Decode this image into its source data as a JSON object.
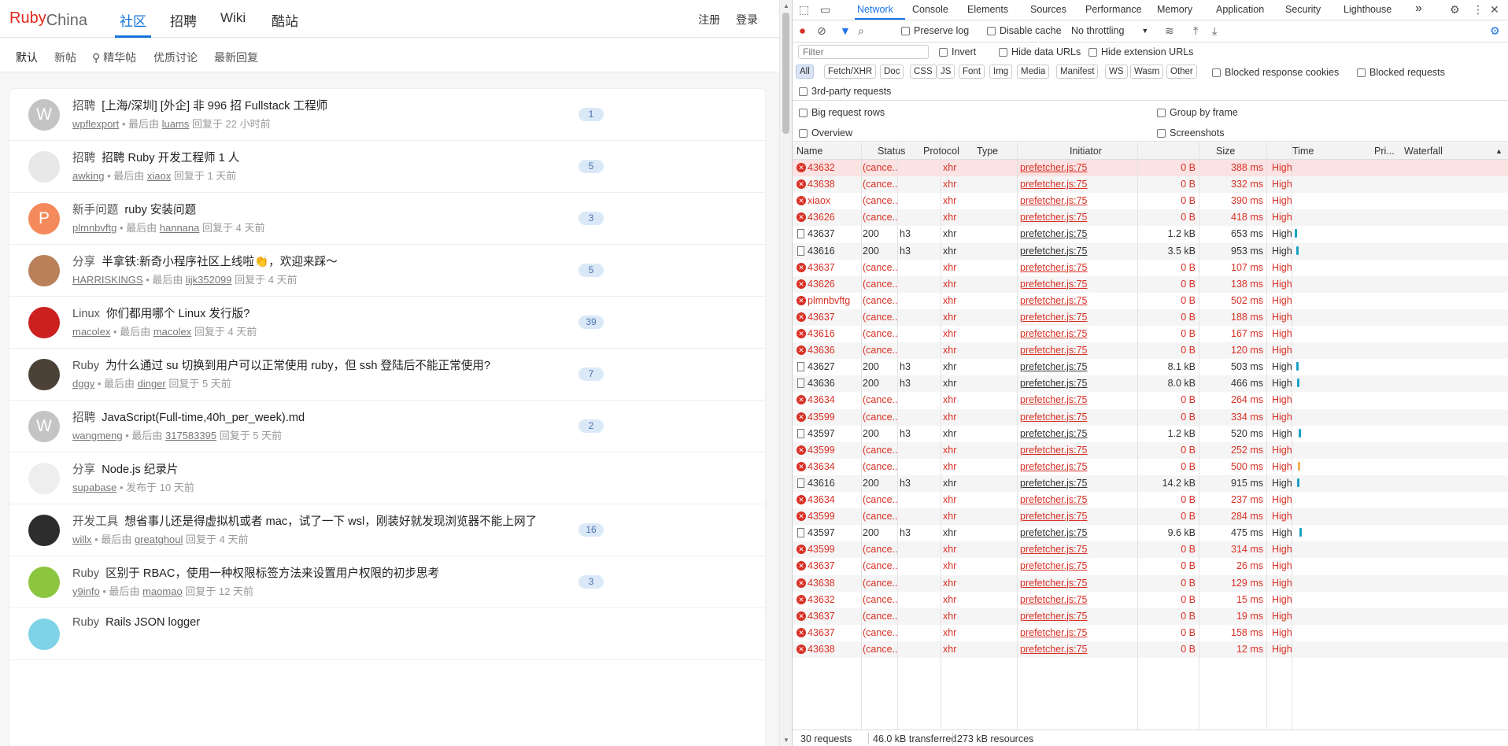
{
  "site": {
    "brand_ruby": "Ruby",
    "brand_china": "China",
    "nav": [
      "社区",
      "招聘",
      "Wiki",
      "酷站"
    ],
    "signup": "注册",
    "login": "登录",
    "subnav": [
      "默认",
      "新帖",
      "精华帖",
      "优质讨论",
      "最新回复"
    ]
  },
  "topics": [
    {
      "avatar_letter": "W",
      "avatar_color": "#c4c4c4",
      "node": "招聘",
      "title": "[上海/深圳] [外企] 非 996 招 Fullstack 工程师",
      "author": "wpflexport",
      "mid": " • 最后由 ",
      "last": "luams",
      "time": " 回复于 22 小时前",
      "count": "1"
    },
    {
      "avatar_letter": "",
      "avatar_color": "#e8e8e8",
      "node": "招聘",
      "title": "招聘 Ruby 开发工程师 1 人",
      "author": "awking",
      "mid": " • 最后由 ",
      "last": "xiaox",
      "time": " 回复于 1 天前",
      "count": "5"
    },
    {
      "avatar_letter": "P",
      "avatar_color": "#f48a5c",
      "node": "新手问题",
      "title": "ruby 安装问题",
      "author": "plmnbvftg",
      "mid": " • 最后由 ",
      "last": "hannana",
      "time": " 回复于 4 天前",
      "count": "3"
    },
    {
      "avatar_letter": "",
      "avatar_color": "#b9805a",
      "node": "分享",
      "title": "半拿铁:新奇小程序社区上线啦👏，欢迎来踩～",
      "author": "HARRISKINGS",
      "mid": " • 最后由 ",
      "last": "lijk352099",
      "time": " 回复于 4 天前",
      "count": "5"
    },
    {
      "avatar_letter": "",
      "avatar_color": "#cc1f1f",
      "node": "Linux",
      "title": "你们都用哪个 Linux 发行版?",
      "author": "macolex",
      "mid": " • 最后由 ",
      "last": "macolex",
      "time": " 回复于 4 天前",
      "count": "39"
    },
    {
      "avatar_letter": "",
      "avatar_color": "#4b4136",
      "node": "Ruby",
      "title": "为什么通过 su 切换到用户可以正常使用 ruby，但 ssh 登陆后不能正常使用?",
      "author": "dggy",
      "mid": " • 最后由 ",
      "last": "dinger",
      "time": " 回复于 5 天前",
      "count": "7"
    },
    {
      "avatar_letter": "W",
      "avatar_color": "#c4c4c4",
      "node": "招聘",
      "title": "JavaScript(Full-time,40h_per_week).md",
      "author": "wangmeng",
      "mid": " • 最后由 ",
      "last": "317583395",
      "time": " 回复于 5 天前",
      "count": "2"
    },
    {
      "avatar_letter": "",
      "avatar_color": "#eeeeee",
      "node": "分享",
      "title": "Node.js 纪录片",
      "author": "supabase",
      "mid": " • 发布于 10 天前",
      "last": "",
      "time": "",
      "count": ""
    },
    {
      "avatar_letter": "",
      "avatar_color": "#2d2d2d",
      "node": "开发工具",
      "title": "想省事儿还是得虚拟机或者 mac，试了一下 wsl，刚装好就发现浏览器不能上网了",
      "author": "willx",
      "mid": " • 最后由 ",
      "last": "greatghoul",
      "time": " 回复于 4 天前",
      "count": "16"
    },
    {
      "avatar_letter": "",
      "avatar_color": "#8cc63f",
      "node": "Ruby",
      "title": "区别于 RBAC，使用一种权限标签方法来设置用户权限的初步思考",
      "author": "y9info",
      "mid": " • 最后由 ",
      "last": "maomao",
      "time": " 回复于 12 天前",
      "count": "3"
    },
    {
      "avatar_letter": "",
      "avatar_color": "#7fd3e6",
      "node": "Ruby",
      "title": "Rails JSON logger",
      "author": "",
      "mid": "",
      "last": "",
      "time": "",
      "count": ""
    }
  ],
  "devtools": {
    "tabs": [
      "Network",
      "Console",
      "Elements",
      "Sources",
      "Performance",
      "Memory",
      "Application",
      "Security",
      "Lighthouse"
    ],
    "more": "»",
    "preserve_log": "Preserve log",
    "disable_cache": "Disable cache",
    "throttling": "No throttling",
    "filter_placeholder": "Filter",
    "invert": "Invert",
    "hide_data_urls": "Hide data URLs",
    "hide_ext_urls": "Hide extension URLs",
    "type_chips": [
      "All",
      "Fetch/XHR",
      "Doc",
      "CSS",
      "JS",
      "Font",
      "Img",
      "Media",
      "Manifest",
      "WS",
      "Wasm",
      "Other"
    ],
    "blocked_cookies": "Blocked response cookies",
    "blocked_requests": "Blocked requests",
    "third_party": "3rd-party requests",
    "big_rows": "Big request rows",
    "group_by_frame": "Group by frame",
    "overview": "Overview",
    "screenshots": "Screenshots",
    "columns": [
      "Name",
      "Status",
      "Protocol",
      "Type",
      "Initiator",
      "Size",
      "Time",
      "Pri...",
      "Waterfall"
    ],
    "requests": [
      {
        "name": "43632",
        "status": "(cance...",
        "protocol": "",
        "type": "xhr",
        "initiator": "prefetcher.js:75",
        "size": "0 B",
        "time": "388 ms",
        "priority": "High",
        "error": true,
        "wf": 0
      },
      {
        "name": "43638",
        "status": "(cance...",
        "protocol": "",
        "type": "xhr",
        "initiator": "prefetcher.js:75",
        "size": "0 B",
        "time": "332 ms",
        "priority": "High",
        "error": true,
        "wf": 0
      },
      {
        "name": "xiaox",
        "status": "(cance...",
        "protocol": "",
        "type": "xhr",
        "initiator": "prefetcher.js:75",
        "size": "0 B",
        "time": "390 ms",
        "priority": "High",
        "error": true,
        "wf": 0
      },
      {
        "name": "43626",
        "status": "(cance...",
        "protocol": "",
        "type": "xhr",
        "initiator": "prefetcher.js:75",
        "size": "0 B",
        "time": "418 ms",
        "priority": "High",
        "error": true,
        "wf": 0
      },
      {
        "name": "43637",
        "status": "200",
        "protocol": "h3",
        "type": "xhr",
        "initiator": "prefetcher.js:75",
        "size": "1.2 kB",
        "time": "653 ms",
        "priority": "High",
        "error": false,
        "wf": 1
      },
      {
        "name": "43616",
        "status": "200",
        "protocol": "h3",
        "type": "xhr",
        "initiator": "prefetcher.js:75",
        "size": "3.5 kB",
        "time": "953 ms",
        "priority": "High",
        "error": false,
        "wf": 2
      },
      {
        "name": "43637",
        "status": "(cance...",
        "protocol": "",
        "type": "xhr",
        "initiator": "prefetcher.js:75",
        "size": "0 B",
        "time": "107 ms",
        "priority": "High",
        "error": true,
        "wf": 0
      },
      {
        "name": "43626",
        "status": "(cance...",
        "protocol": "",
        "type": "xhr",
        "initiator": "prefetcher.js:75",
        "size": "0 B",
        "time": "138 ms",
        "priority": "High",
        "error": true,
        "wf": 0
      },
      {
        "name": "plmnbvftg",
        "status": "(cance...",
        "protocol": "",
        "type": "xhr",
        "initiator": "prefetcher.js:75",
        "size": "0 B",
        "time": "502 ms",
        "priority": "High",
        "error": true,
        "wf": 0
      },
      {
        "name": "43637",
        "status": "(cance...",
        "protocol": "",
        "type": "xhr",
        "initiator": "prefetcher.js:75",
        "size": "0 B",
        "time": "188 ms",
        "priority": "High",
        "error": true,
        "wf": 0
      },
      {
        "name": "43616",
        "status": "(cance...",
        "protocol": "",
        "type": "xhr",
        "initiator": "prefetcher.js:75",
        "size": "0 B",
        "time": "167 ms",
        "priority": "High",
        "error": true,
        "wf": 0
      },
      {
        "name": "43636",
        "status": "(cance...",
        "protocol": "",
        "type": "xhr",
        "initiator": "prefetcher.js:75",
        "size": "0 B",
        "time": "120 ms",
        "priority": "High",
        "error": true,
        "wf": 0
      },
      {
        "name": "43627",
        "status": "200",
        "protocol": "h3",
        "type": "xhr",
        "initiator": "prefetcher.js:75",
        "size": "8.1 kB",
        "time": "503 ms",
        "priority": "High",
        "error": false,
        "wf": 2
      },
      {
        "name": "43636",
        "status": "200",
        "protocol": "h3",
        "type": "xhr",
        "initiator": "prefetcher.js:75",
        "size": "8.0 kB",
        "time": "466 ms",
        "priority": "High",
        "error": false,
        "wf": 3
      },
      {
        "name": "43634",
        "status": "(cance...",
        "protocol": "",
        "type": "xhr",
        "initiator": "prefetcher.js:75",
        "size": "0 B",
        "time": "264 ms",
        "priority": "High",
        "error": true,
        "wf": 0
      },
      {
        "name": "43599",
        "status": "(cance...",
        "protocol": "",
        "type": "xhr",
        "initiator": "prefetcher.js:75",
        "size": "0 B",
        "time": "334 ms",
        "priority": "High",
        "error": true,
        "wf": 0
      },
      {
        "name": "43597",
        "status": "200",
        "protocol": "h3",
        "type": "xhr",
        "initiator": "prefetcher.js:75",
        "size": "1.2 kB",
        "time": "520 ms",
        "priority": "High",
        "error": false,
        "wf": 4
      },
      {
        "name": "43599",
        "status": "(cance...",
        "protocol": "",
        "type": "xhr",
        "initiator": "prefetcher.js:75",
        "size": "0 B",
        "time": "252 ms",
        "priority": "High",
        "error": true,
        "wf": 0
      },
      {
        "name": "43634",
        "status": "(cance...",
        "protocol": "",
        "type": "xhr",
        "initiator": "prefetcher.js:75",
        "size": "0 B",
        "time": "500 ms",
        "priority": "High",
        "error": true,
        "wf": 5
      },
      {
        "name": "43616",
        "status": "200",
        "protocol": "h3",
        "type": "xhr",
        "initiator": "prefetcher.js:75",
        "size": "14.2 kB",
        "time": "915 ms",
        "priority": "High",
        "error": false,
        "wf": 6
      },
      {
        "name": "43634",
        "status": "(cance...",
        "protocol": "",
        "type": "xhr",
        "initiator": "prefetcher.js:75",
        "size": "0 B",
        "time": "237 ms",
        "priority": "High",
        "error": true,
        "wf": 0
      },
      {
        "name": "43599",
        "status": "(cance...",
        "protocol": "",
        "type": "xhr",
        "initiator": "prefetcher.js:75",
        "size": "0 B",
        "time": "284 ms",
        "priority": "High",
        "error": true,
        "wf": 0
      },
      {
        "name": "43597",
        "status": "200",
        "protocol": "h3",
        "type": "xhr",
        "initiator": "prefetcher.js:75",
        "size": "9.6 kB",
        "time": "475 ms",
        "priority": "High",
        "error": false,
        "wf": 7
      },
      {
        "name": "43599",
        "status": "(cance...",
        "protocol": "",
        "type": "xhr",
        "initiator": "prefetcher.js:75",
        "size": "0 B",
        "time": "314 ms",
        "priority": "High",
        "error": true,
        "wf": 0
      },
      {
        "name": "43637",
        "status": "(cance...",
        "protocol": "",
        "type": "xhr",
        "initiator": "prefetcher.js:75",
        "size": "0 B",
        "time": "26 ms",
        "priority": "High",
        "error": true,
        "wf": 0
      },
      {
        "name": "43638",
        "status": "(cance...",
        "protocol": "",
        "type": "xhr",
        "initiator": "prefetcher.js:75",
        "size": "0 B",
        "time": "129 ms",
        "priority": "High",
        "error": true,
        "wf": 0
      },
      {
        "name": "43632",
        "status": "(cance...",
        "protocol": "",
        "type": "xhr",
        "initiator": "prefetcher.js:75",
        "size": "0 B",
        "time": "15 ms",
        "priority": "High",
        "error": true,
        "wf": 0
      },
      {
        "name": "43637",
        "status": "(cance...",
        "protocol": "",
        "type": "xhr",
        "initiator": "prefetcher.js:75",
        "size": "0 B",
        "time": "19 ms",
        "priority": "High",
        "error": true,
        "wf": 0
      },
      {
        "name": "43637",
        "status": "(cance...",
        "protocol": "",
        "type": "xhr",
        "initiator": "prefetcher.js:75",
        "size": "0 B",
        "time": "158 ms",
        "priority": "High",
        "error": true,
        "wf": 0
      },
      {
        "name": "43638",
        "status": "(cance...",
        "protocol": "",
        "type": "xhr",
        "initiator": "prefetcher.js:75",
        "size": "0 B",
        "time": "12 ms",
        "priority": "High",
        "error": true,
        "wf": 0
      }
    ],
    "summary": {
      "requests": "30 requests",
      "transferred": "46.0 kB transferred",
      "resources": "273 kB resources"
    },
    "colors": {
      "accent": "#1a73e8",
      "error": "#d93025",
      "waterfall": "#1ba1c6"
    }
  }
}
